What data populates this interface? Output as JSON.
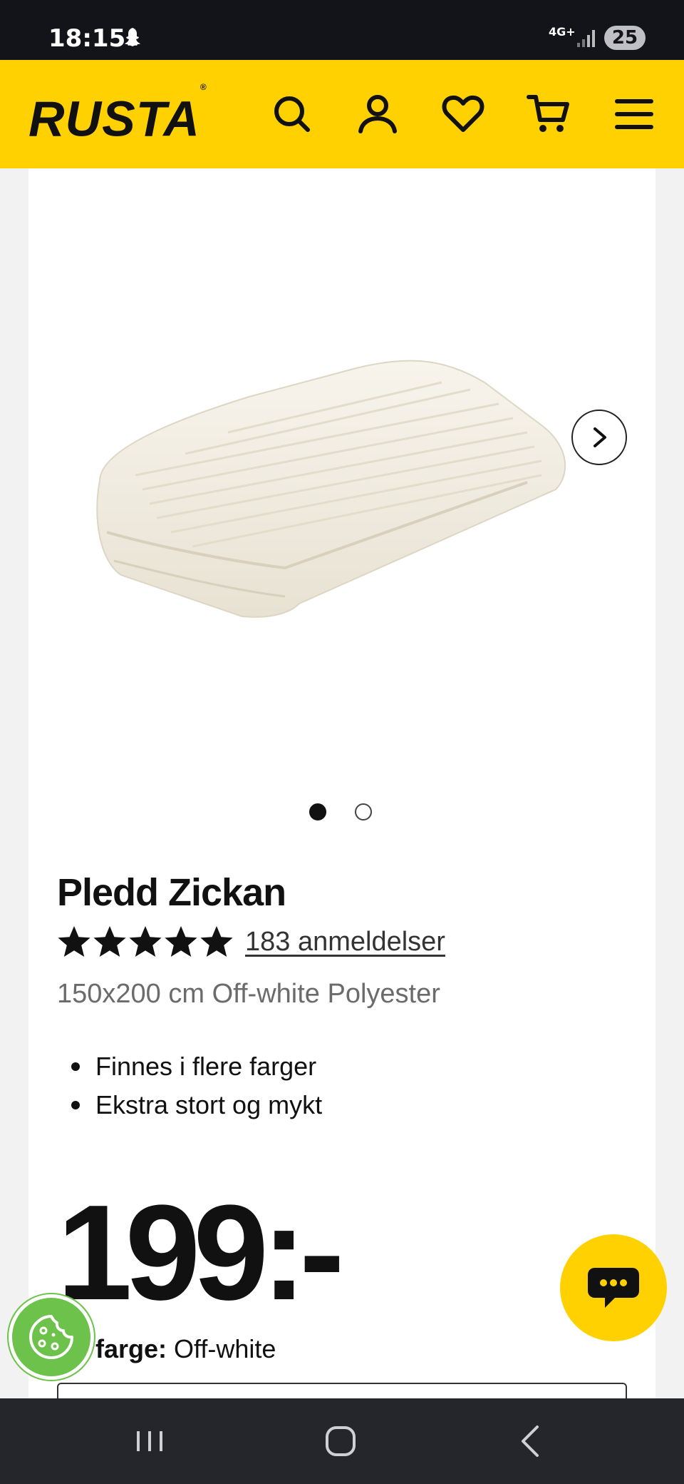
{
  "status_bar": {
    "time": "18:15",
    "network": "4G+",
    "battery": "25"
  },
  "header": {
    "logo": "RUSTA",
    "logo_mark": "®",
    "icons": [
      "search-icon",
      "account-icon",
      "favorites-icon",
      "cart-icon",
      "menu-icon"
    ],
    "brand_color": "#ffd100"
  },
  "gallery": {
    "slide_count": 2,
    "active_slide": 1
  },
  "product": {
    "title": "Pledd Zickan",
    "rating": 5,
    "reviews": "183 anmeldelser",
    "subtitle": "150x200 cm Off-white Polyester",
    "bullets": [
      "Finnes i flere farger",
      "Ekstra stort og mykt"
    ],
    "price": "199:-",
    "color_label": "lgt farge:",
    "color_value": "Off-white"
  },
  "nav": {
    "buttons": [
      "recent-apps-icon",
      "home-icon",
      "back-icon"
    ]
  }
}
